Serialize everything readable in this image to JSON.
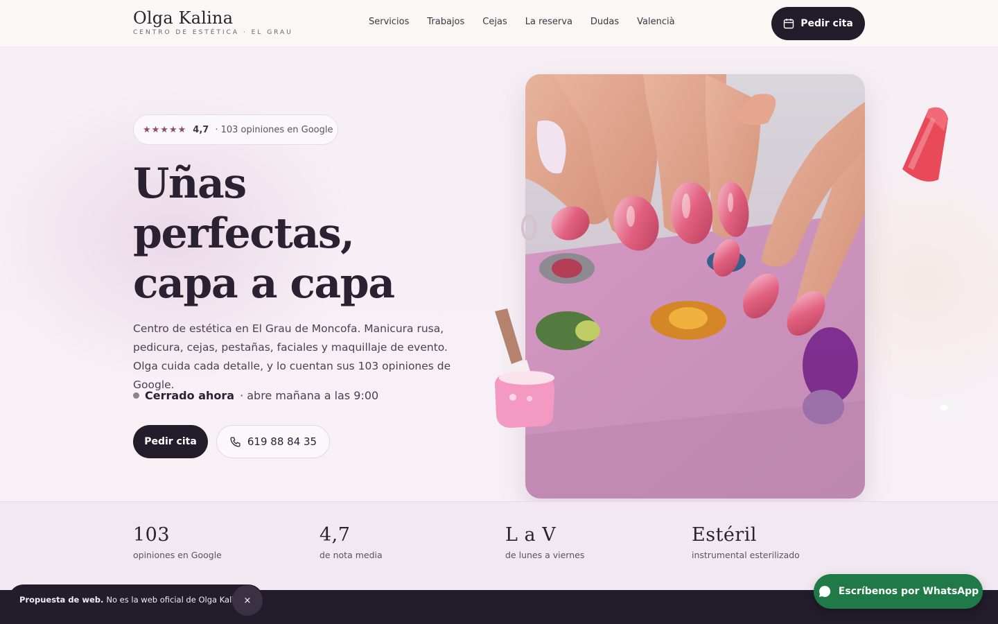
{
  "brand": {
    "name": "Olga Kalina",
    "subtitle": "CENTRO DE ESTÉTICA · EL GRAU"
  },
  "nav": {
    "items": [
      "Servicios",
      "Trabajos",
      "Cejas",
      "La reserva",
      "Dudas",
      "Valencià"
    ]
  },
  "header_cta": {
    "label": "Pedir cita",
    "icon": "calendar-icon"
  },
  "rating": {
    "stars": "★★★★★",
    "score": "4,7",
    "count_text": "· 103 opiniones en Google"
  },
  "hero": {
    "title_lines": [
      "Uñas",
      "perfectas,",
      "capa a capa"
    ],
    "description": "Centro de estética en El Grau de Moncofa. Manicura rusa, pedicura, cejas, pestañas, faciales y maquillaje de evento. Olga cuida cada detalle, y lo cuentan sus 103 opiniones de Google.",
    "status_strong": "Cerrado ahora",
    "status_rest": "· abre mañana a las 9:00",
    "primary_button": "Pedir cita",
    "phone_button": "619 88 84 35"
  },
  "stats": [
    {
      "value": "103",
      "label": "opiniones en Google"
    },
    {
      "value": "4,7",
      "label": "de nota media"
    },
    {
      "value": "L a V",
      "label": "de lunes a viernes"
    },
    {
      "value": "Estéril",
      "label": "instrumental esterilizado"
    }
  ],
  "notice": {
    "strong": "Propuesta de web.",
    "text": "No es la web oficial de Olga Kalina.",
    "close": "×"
  },
  "whatsapp": {
    "label": "Escríbenos por WhatsApp"
  },
  "colors": {
    "dark": "#231c2b",
    "accent": "#8e4a74",
    "whatsapp": "#1f7a48",
    "background": "#f6f0f5"
  }
}
